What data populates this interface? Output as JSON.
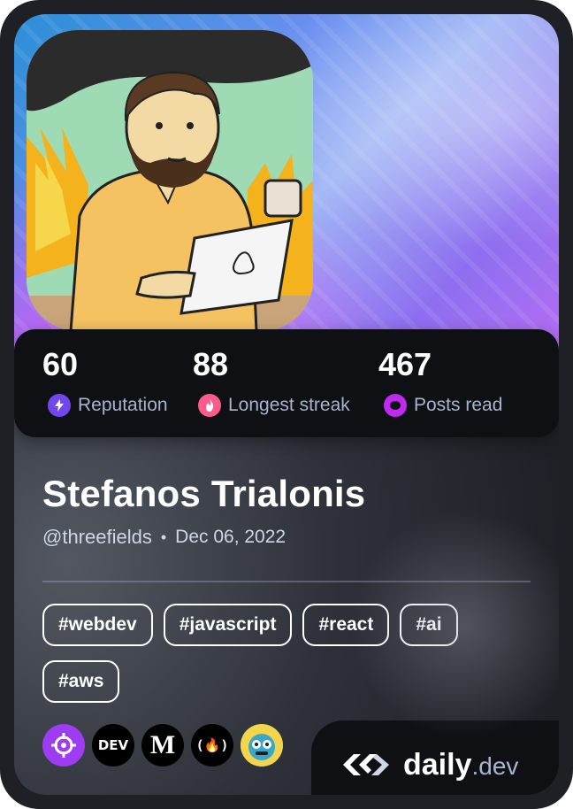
{
  "profile": {
    "name": "Stefanos Trialonis",
    "handle": "@threefields",
    "separator": "•",
    "joined": "Dec 06, 2022"
  },
  "stats": [
    {
      "value": "60",
      "label": "Reputation",
      "icon": "lightning-icon",
      "color": "#7147ed"
    },
    {
      "value": "88",
      "label": "Longest streak",
      "icon": "flame-icon",
      "color": "#ff5a8c"
    },
    {
      "value": "467",
      "label": "Posts read",
      "icon": "eye-ring-icon",
      "color": "#c029f0"
    }
  ],
  "tags": [
    "#webdev",
    "#javascript",
    "#react",
    "#ai",
    "#aws"
  ],
  "sources": [
    {
      "name": "crosshair-source-icon",
      "label": ""
    },
    {
      "name": "dev-source-icon",
      "label": "DEV"
    },
    {
      "name": "medium-source-icon",
      "label": "M"
    },
    {
      "name": "freecodecamp-source-icon",
      "label": "(🔥)"
    },
    {
      "name": "robot-source-icon",
      "label": ""
    }
  ],
  "brand": {
    "name": "daily",
    "suffix": ".dev"
  },
  "colors": {
    "card_bg": "#1e2026",
    "stats_bg": "#0f1014",
    "label": "#a8b3cf"
  }
}
